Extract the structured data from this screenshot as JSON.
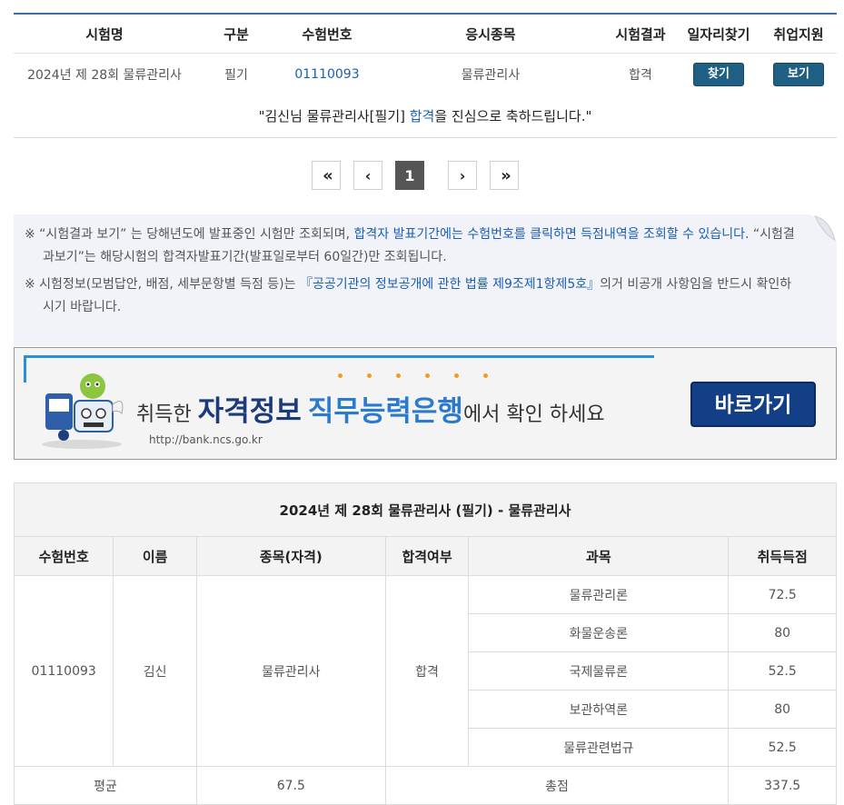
{
  "summary": {
    "headers": [
      "시험명",
      "구분",
      "수험번호",
      "응시종목",
      "시험결과",
      "일자리찾기",
      "취업지원"
    ],
    "exam_name": "2024년 제 28회 물류관리사",
    "type": "필기",
    "exam_number": "01110093",
    "subject": "물류관리사",
    "result": "합격",
    "find_job_button": "찾기",
    "support_button": "보기"
  },
  "congrats": {
    "prefix": "\"김신님 물류관리사[필기] ",
    "highlight": "합격",
    "suffix": "을 진심으로 축하드립니다.\""
  },
  "pager": {
    "first": "«",
    "prev": "‹",
    "current": "1",
    "next": "›",
    "last": "»"
  },
  "notice": {
    "line1_a": "※ “시험결과 보기” 는 당해년도에 발표중인 시험만 조회되며, ",
    "line1_b": "합격자 발표기간에는 수험번호를 클릭하면 득점내역을 조회할 수 있습니다.",
    "line1_c": " “시험결과보기”는 해당시험의 합격자발표기간(발표일로부터 60일간)만 조회됩니다.",
    "line2_a": "※ 시험정보(모범답안, 배점, 세부문항별 득점 등)는 ",
    "line2_b": "『공공기관의 정보공개에 관한 법률 제9조제1항제5호』",
    "line2_c": "의거 비공개 사항임을 반드시 확인하시기 바랍니다."
  },
  "banner": {
    "text_a": "취득한 ",
    "text_b": "자격정보",
    "text_c": " ",
    "text_d": "직무능력은행",
    "text_e": "에서 확인 하세요",
    "url": "http://bank.ncs.go.kr",
    "button": "바로가기"
  },
  "detail": {
    "caption": "2024년 제 28회 물류관리사 (필기) - 물류관리사",
    "headers": [
      "수험번호",
      "이름",
      "종목(자격)",
      "합격여부",
      "과목",
      "취득득점"
    ],
    "exam_number": "01110093",
    "name": "김신",
    "qualification": "물류관리사",
    "pass": "합격",
    "subjects": [
      {
        "name": "물류관리론",
        "score": "72.5"
      },
      {
        "name": "화물운송론",
        "score": "80"
      },
      {
        "name": "국제물류론",
        "score": "52.5"
      },
      {
        "name": "보관하역론",
        "score": "80"
      },
      {
        "name": "물류관련법규",
        "score": "52.5"
      }
    ],
    "average_label": "평균",
    "average": "67.5",
    "total_label": "총점",
    "total": "337.5"
  },
  "colors": {
    "accent": "#3a6ea5",
    "link": "#1b5fb4",
    "button": "#1f5f83",
    "banner_button": "#123f86"
  }
}
